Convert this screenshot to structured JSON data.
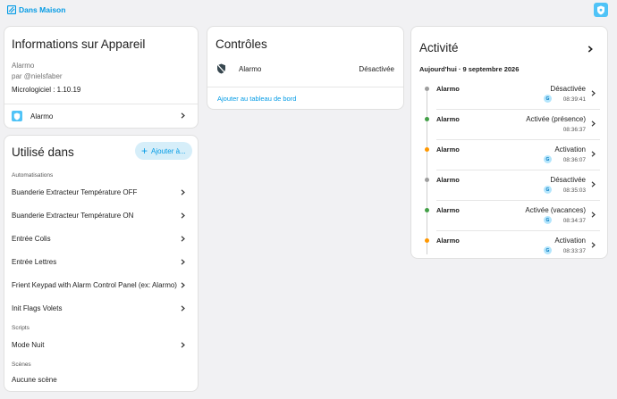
{
  "breadcrumb": {
    "label": "Dans Maison"
  },
  "colors": {
    "accent": "#039be5",
    "badge": "#4fc3f7",
    "dot_grey": "#9e9e9e",
    "dot_green": "#43a047",
    "dot_orange": "#ff9800"
  },
  "device_info": {
    "title": "Informations sur Appareil",
    "model": "Alarmo",
    "author": "par @nielsfaber",
    "firmware": "Micrologiciel : 1.10.19",
    "entity_label": "Alarmo"
  },
  "used_in": {
    "title": "Utilisé dans",
    "add_button": "Ajouter à...",
    "automations_label": "Automatisations",
    "automations": [
      "Buanderie Extracteur Température OFF",
      "Buanderie Extracteur Température ON",
      "Entrée Colis",
      "Entrée Lettres",
      "Frient Keypad with Alarm Control Panel (ex: Alarmo)",
      "Init Flags Volets"
    ],
    "scripts_label": "Scripts",
    "scripts": [
      "Mode Nuit"
    ],
    "scenes_label": "Scènes",
    "scenes_empty": "Aucune scène"
  },
  "controls": {
    "title": "Contrôles",
    "entity_name": "Alarmo",
    "entity_state": "Désactivée",
    "add_dashboard": "Ajouter au tableau de bord"
  },
  "activity": {
    "title": "Activité",
    "date": "Aujourd'hui · 9 septembre 2026",
    "entries": [
      {
        "entity": "Alarmo",
        "state": "Désactivée",
        "time": "08:39:41",
        "dot": "grey",
        "user": "G"
      },
      {
        "entity": "Alarmo",
        "state": "Activée (présence)",
        "time": "08:36:37",
        "dot": "green",
        "user": ""
      },
      {
        "entity": "Alarmo",
        "state": "Activation",
        "time": "08:36:07",
        "dot": "orange",
        "user": "G"
      },
      {
        "entity": "Alarmo",
        "state": "Désactivée",
        "time": "08:35:03",
        "dot": "grey",
        "user": "G"
      },
      {
        "entity": "Alarmo",
        "state": "Activée (vacances)",
        "time": "08:34:37",
        "dot": "green",
        "user": "G"
      },
      {
        "entity": "Alarmo",
        "state": "Activation",
        "time": "08:33:37",
        "dot": "orange",
        "user": "G"
      }
    ]
  }
}
